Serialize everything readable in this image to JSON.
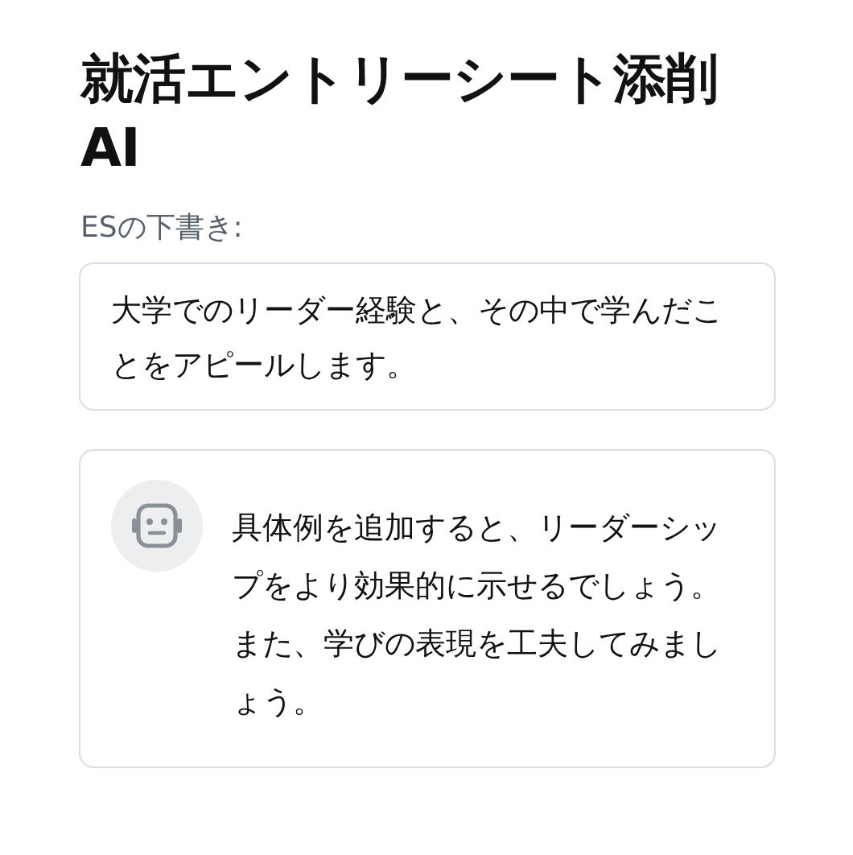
{
  "title": "就活エントリーシート添削AI",
  "draft": {
    "label": "ESの下書き:",
    "value": "大学でのリーダー経験と、その中で学んだことをアピールします。"
  },
  "feedback": {
    "text": "具体例を追加すると、リーダーシップをより効果的に示せるでしょう。また、学びの表現を工夫してみましょう。"
  }
}
